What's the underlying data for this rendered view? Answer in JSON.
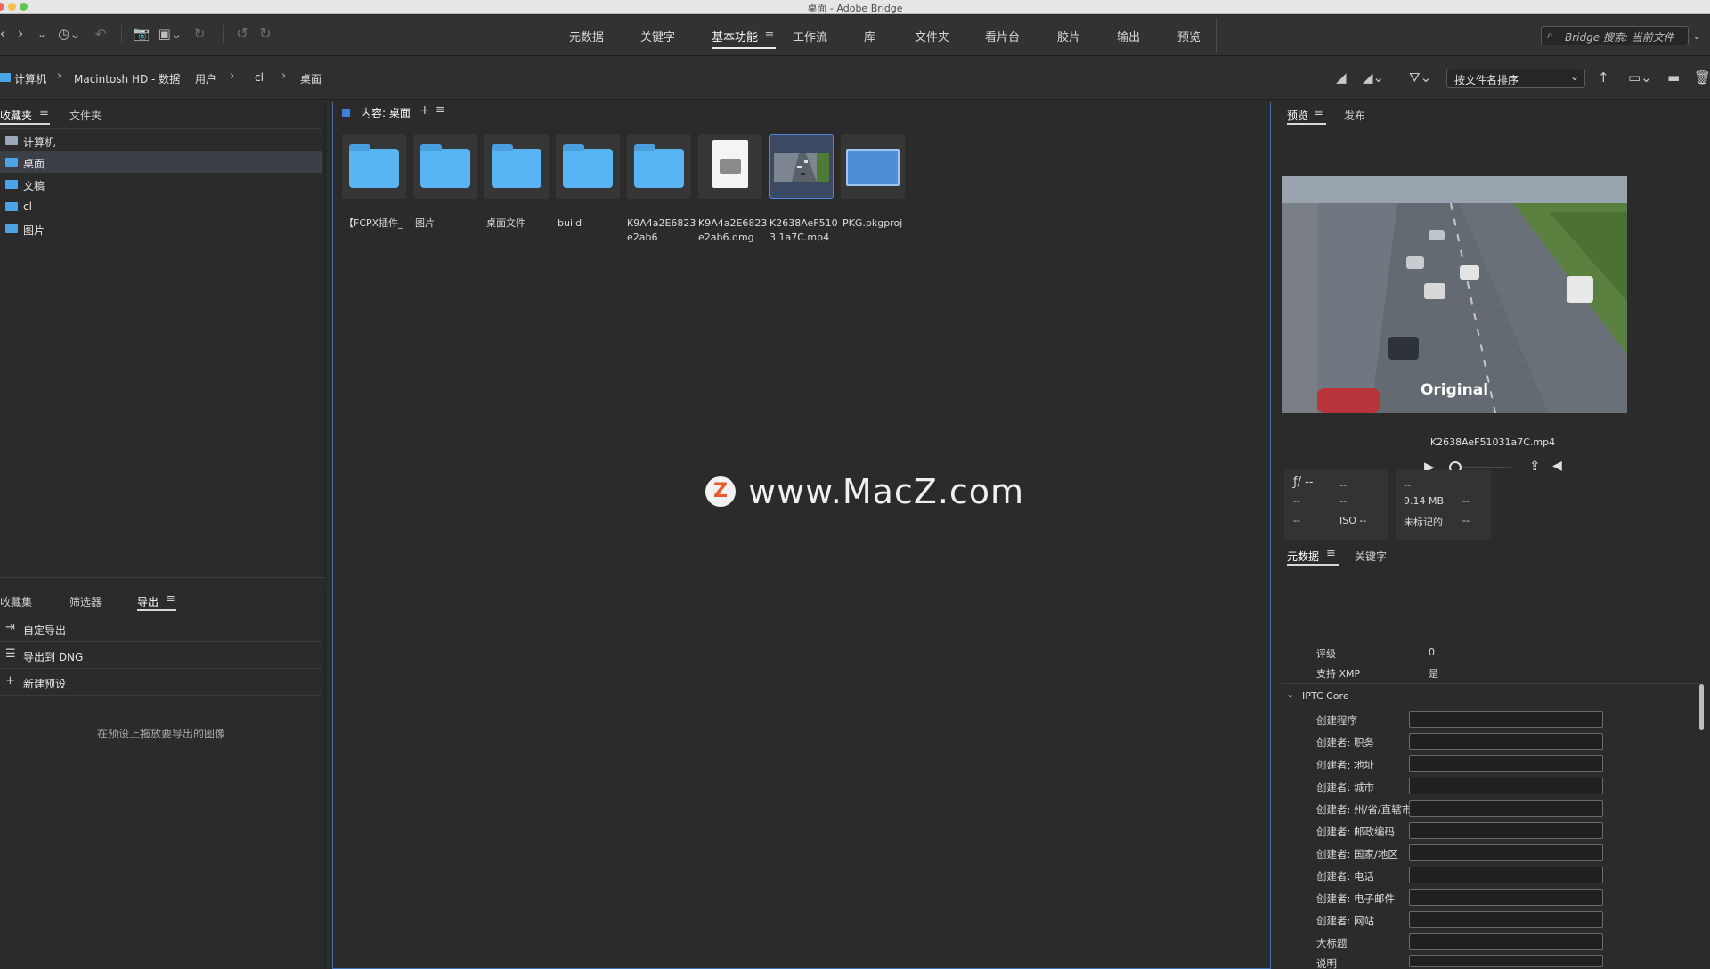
{
  "window": {
    "title": "桌面 - Adobe Bridge"
  },
  "toolbar": {
    "workspaces": [
      {
        "label": "元数据"
      },
      {
        "label": "关键字"
      },
      {
        "label": "基本功能"
      },
      {
        "label": "工作流"
      },
      {
        "label": "库"
      },
      {
        "label": "文件夹"
      },
      {
        "label": "看片台"
      },
      {
        "label": "胶片"
      },
      {
        "label": "输出"
      },
      {
        "label": "预览"
      }
    ],
    "active_workspace": "基本功能",
    "search_placeholder": "Bridge 搜索: 当前文件"
  },
  "path": {
    "crumbs": [
      "计算机",
      "Macintosh HD - 数据",
      "用户",
      "cl",
      "桌面"
    ],
    "sort_label": "按文件名排序"
  },
  "favorites_panel": {
    "tabs": [
      "收藏夹",
      "文件夹"
    ],
    "items": [
      "计算机",
      "桌面",
      "文稿",
      "cl",
      "图片"
    ],
    "selected": "桌面"
  },
  "export_panel": {
    "tabs": [
      "收藏集",
      "筛选器",
      "导出"
    ],
    "rows": [
      "自定导出",
      "导出到 DNG",
      "新建预设"
    ],
    "hint": "在预设上拖放要导出的图像"
  },
  "content": {
    "header": "内容: 桌面",
    "items": [
      {
        "name": "【FCPX插件_",
        "kind": "folder"
      },
      {
        "name": "图片",
        "kind": "folder"
      },
      {
        "name": "桌面文件",
        "kind": "folder"
      },
      {
        "name": "build",
        "kind": "folder"
      },
      {
        "name": "K9A4a2E6823e2ab6",
        "kind": "folder"
      },
      {
        "name": "K9A4a2E6823e2ab6.dmg",
        "kind": "dmg"
      },
      {
        "name": "K2638AeF5103 1a7C.mp4",
        "kind": "video"
      },
      {
        "name": "PKG.pkgproj",
        "kind": "pkg"
      }
    ],
    "watermark": "www.MacZ.com"
  },
  "preview_panel": {
    "tabs": [
      "预览",
      "发布"
    ],
    "overlay_text": "Original",
    "filename": "K2638AeF51031a7C.mp4"
  },
  "metadata_panel": {
    "tabs": [
      "元数据",
      "关键字"
    ],
    "camera": {
      "aperture": "ƒ/ --",
      "c1r1": "--",
      "c2r1": "--",
      "c0r2": "--",
      "c1r2": "--",
      "size": "9.14 MB",
      "c3r2": "--",
      "c0r3": "--",
      "iso": "ISO --",
      "label": "未标记的",
      "c3r3": "--"
    },
    "rating_label": "评级",
    "rating_value": "0",
    "xmp_label": "支持 XMP",
    "xmp_value": "是",
    "section": "IPTC Core",
    "fields": [
      "创建程序",
      "创建者: 职务",
      "创建者: 地址",
      "创建者: 城市",
      "创建者: 州/省/直辖市...",
      "创建者: 邮政编码",
      "创建者: 国家/地区",
      "创建者: 电话",
      "创建者: 电子邮件",
      "创建者: 网站",
      "大标题",
      "说明"
    ]
  },
  "colors": {
    "accent": "#4f86d8",
    "folder": "#58b4f2",
    "panel_bg": "#2b2b2b"
  }
}
